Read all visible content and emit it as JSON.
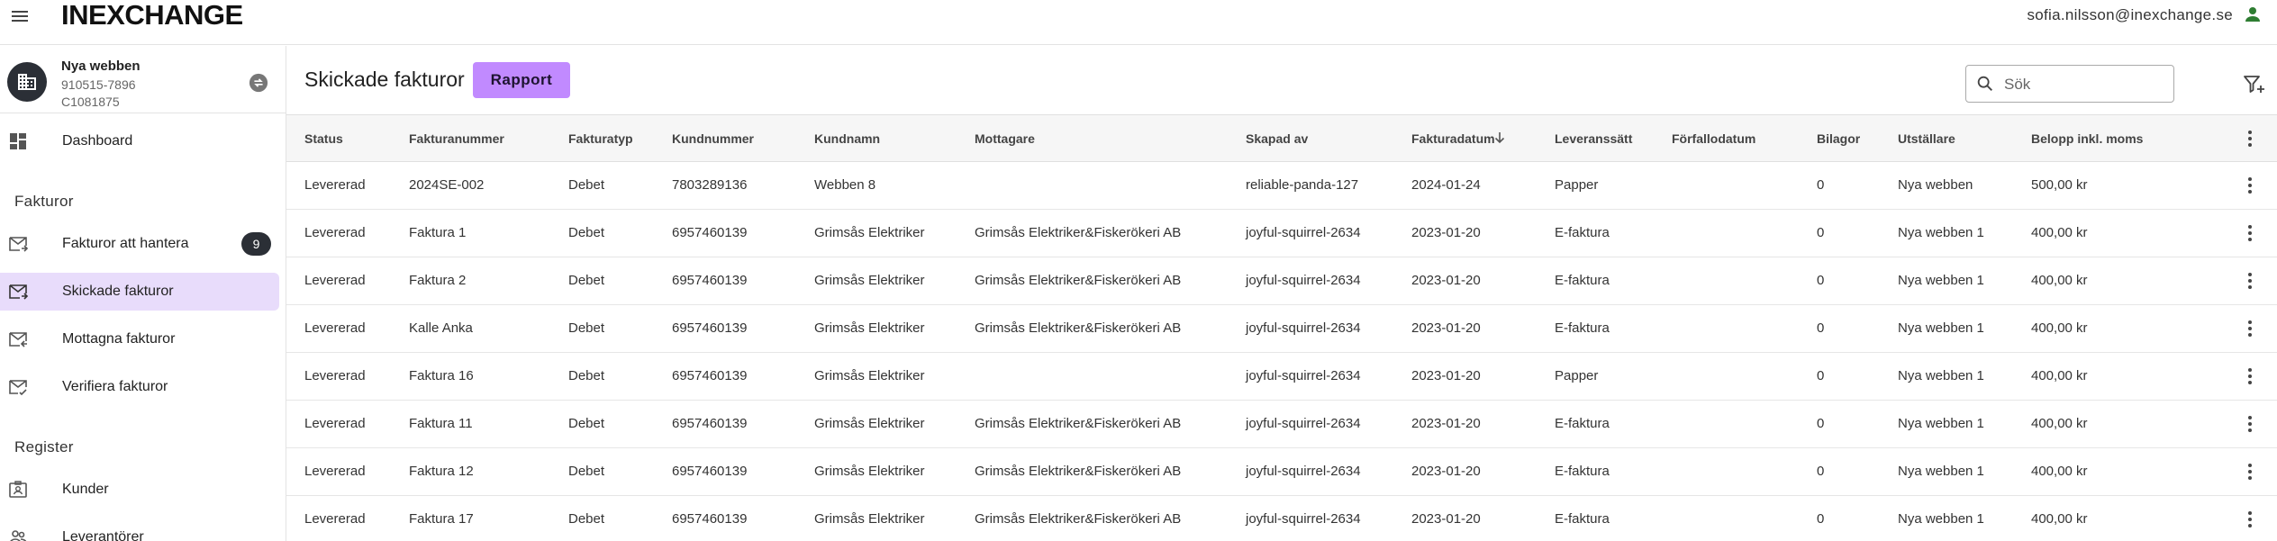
{
  "app": {
    "logo": "INEXCHANGE",
    "user_email": "sofia.nilsson@inexchange.se"
  },
  "org": {
    "name": "Nya webben",
    "org_number": "910515-7896",
    "customer_id": "C1081875"
  },
  "sidebar": {
    "dashboard": {
      "label": "Dashboard"
    },
    "section_invoices": "Fakturor",
    "invoices_to_handle": {
      "label": "Fakturor att hantera",
      "badge": "9"
    },
    "sent_invoices": {
      "label": "Skickade fakturor"
    },
    "received_invoices": {
      "label": "Mottagna fakturor"
    },
    "verify_invoices": {
      "label": "Verifiera fakturor"
    },
    "section_register": "Register",
    "customers": {
      "label": "Kunder"
    },
    "suppliers": {
      "label": "Leverantörer"
    }
  },
  "page": {
    "title": "Skickade fakturor",
    "report_button": "Rapport",
    "search_placeholder": "Sök"
  },
  "table": {
    "columns": {
      "status": "Status",
      "invoice_number": "Fakturanummer",
      "invoice_type": "Fakturatyp",
      "customer_number": "Kundnummer",
      "customer_name": "Kundnamn",
      "recipient": "Mottagare",
      "created_by": "Skapad av",
      "invoice_date": "Fakturadatum",
      "delivery_method": "Leveranssätt",
      "due_date": "Förfallodatum",
      "attachments": "Bilagor",
      "issuer": "Utställare",
      "amount": "Belopp inkl. moms"
    },
    "sort_column": "invoice_date",
    "sort_direction": "descending",
    "rows": [
      {
        "status": "Levererad",
        "invoice_number": "2024SE-002",
        "invoice_type": "Debet",
        "customer_number": "7803289136",
        "customer_name": "Webben 8",
        "recipient": "",
        "created_by": "reliable-panda-127",
        "invoice_date": "2024-01-24",
        "delivery_method": "Papper",
        "due_date": "",
        "attachments": "0",
        "issuer": "Nya webben",
        "amount": "500,00 kr"
      },
      {
        "status": "Levererad",
        "invoice_number": "Faktura 1",
        "invoice_type": "Debet",
        "customer_number": "6957460139",
        "customer_name": "Grimsås Elektriker",
        "recipient": "Grimsås Elektriker&Fiskerökeri AB",
        "created_by": "joyful-squirrel-2634",
        "invoice_date": "2023-01-20",
        "delivery_method": "E-faktura",
        "due_date": "",
        "attachments": "0",
        "issuer": "Nya webben 1",
        "amount": "400,00 kr"
      },
      {
        "status": "Levererad",
        "invoice_number": "Faktura 2",
        "invoice_type": "Debet",
        "customer_number": "6957460139",
        "customer_name": "Grimsås Elektriker",
        "recipient": "Grimsås Elektriker&Fiskerökeri AB",
        "created_by": "joyful-squirrel-2634",
        "invoice_date": "2023-01-20",
        "delivery_method": "E-faktura",
        "due_date": "",
        "attachments": "0",
        "issuer": "Nya webben 1",
        "amount": "400,00 kr"
      },
      {
        "status": "Levererad",
        "invoice_number": "Kalle Anka",
        "invoice_type": "Debet",
        "customer_number": "6957460139",
        "customer_name": "Grimsås Elektriker",
        "recipient": "Grimsås Elektriker&Fiskerökeri AB",
        "created_by": "joyful-squirrel-2634",
        "invoice_date": "2023-01-20",
        "delivery_method": "E-faktura",
        "due_date": "",
        "attachments": "0",
        "issuer": "Nya webben 1",
        "amount": "400,00 kr"
      },
      {
        "status": "Levererad",
        "invoice_number": "Faktura 16",
        "invoice_type": "Debet",
        "customer_number": "6957460139",
        "customer_name": "Grimsås Elektriker",
        "recipient": "",
        "created_by": "joyful-squirrel-2634",
        "invoice_date": "2023-01-20",
        "delivery_method": "Papper",
        "due_date": "",
        "attachments": "0",
        "issuer": "Nya webben 1",
        "amount": "400,00 kr"
      },
      {
        "status": "Levererad",
        "invoice_number": "Faktura 11",
        "invoice_type": "Debet",
        "customer_number": "6957460139",
        "customer_name": "Grimsås Elektriker",
        "recipient": "Grimsås Elektriker&Fiskerökeri AB",
        "created_by": "joyful-squirrel-2634",
        "invoice_date": "2023-01-20",
        "delivery_method": "E-faktura",
        "due_date": "",
        "attachments": "0",
        "issuer": "Nya webben 1",
        "amount": "400,00 kr"
      },
      {
        "status": "Levererad",
        "invoice_number": "Faktura 12",
        "invoice_type": "Debet",
        "customer_number": "6957460139",
        "customer_name": "Grimsås Elektriker",
        "recipient": "Grimsås Elektriker&Fiskerökeri AB",
        "created_by": "joyful-squirrel-2634",
        "invoice_date": "2023-01-20",
        "delivery_method": "E-faktura",
        "due_date": "",
        "attachments": "0",
        "issuer": "Nya webben 1",
        "amount": "400,00 kr"
      },
      {
        "status": "Levererad",
        "invoice_number": "Faktura 17",
        "invoice_type": "Debet",
        "customer_number": "6957460139",
        "customer_name": "Grimsås Elektriker",
        "recipient": "Grimsås Elektriker&Fiskerökeri AB",
        "created_by": "joyful-squirrel-2634",
        "invoice_date": "2023-01-20",
        "delivery_method": "E-faktura",
        "due_date": "",
        "attachments": "0",
        "issuer": "Nya webben 1",
        "amount": "400,00 kr"
      }
    ]
  },
  "icons": {
    "menu": "menu-icon",
    "user": "account-icon",
    "org": "building-icon",
    "switch": "swap-icon",
    "dashboard": "dashboard-icon",
    "mail_in": "inbox-mail-icon",
    "mail_out": "sent-mail-icon",
    "mail_received": "received-mail-icon",
    "mail_verify": "verify-mail-icon",
    "customers": "contact-card-icon",
    "suppliers": "people-icon",
    "search": "search-icon",
    "filter": "filter-add-icon",
    "row_menu": "more-vert-icon",
    "sort": "arrow-down-icon"
  },
  "colors": {
    "accent": "#c18aff",
    "active_nav": "#e8dcfb",
    "dark": "#2b2f36",
    "user_icon": "#2e7d32"
  }
}
